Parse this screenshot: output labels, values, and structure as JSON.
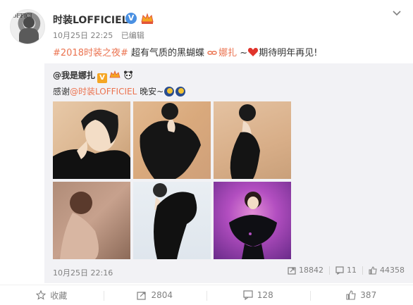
{
  "post": {
    "username": "时装LOFFICIEL",
    "verified_badge": "V",
    "avatar_mast": "OFFICI",
    "date": "10月25日 22:25",
    "edited": "已编辑",
    "hashtag": "#2018时装之夜#",
    "body": " 超有气质的黑蝴蝶 ",
    "link_label": "娜扎",
    "closing": " ~",
    "closing2": "期待明年再见!"
  },
  "repost": {
    "author": "@我是娜扎",
    "author_badge": "V",
    "text_prefix": "感谢",
    "mention": "@时装LOFFICIEL",
    "text_suffix": " 晚安~",
    "date": "10月25日 22:16",
    "reposts": "18842",
    "comments": "11",
    "likes": "44358"
  },
  "actions": {
    "favorite": "收藏",
    "repost": "2804",
    "comment": "128",
    "like": "387"
  },
  "colors": {
    "accent": "#eb7350",
    "verified": "#4a90e2",
    "repost_bg": "#f2f2f5"
  },
  "icons": [
    "chevron-down-icon",
    "verified-icon",
    "crown-icon",
    "heart-icon",
    "link-icon",
    "moon-icon",
    "star-icon",
    "repost-icon",
    "comment-icon",
    "like-icon"
  ]
}
